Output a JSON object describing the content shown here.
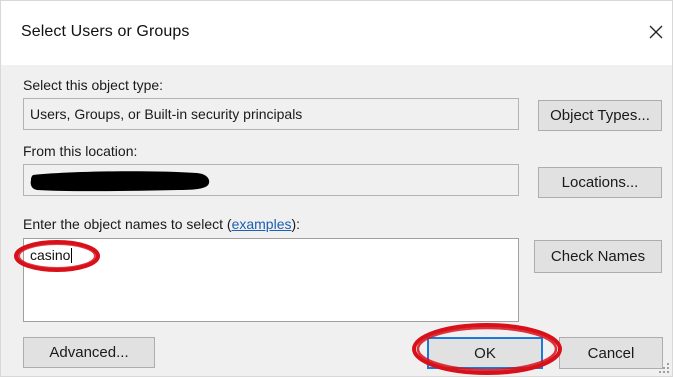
{
  "window": {
    "title": "Select Users or Groups",
    "close_icon": "close-icon"
  },
  "object_type": {
    "label": "Select this object type:",
    "value": "Users, Groups, or Built-in security principals",
    "button_label": "Object Types..."
  },
  "location": {
    "label": "From this location:",
    "value_redacted": true,
    "button_label": "Locations..."
  },
  "names": {
    "label_prefix": "Enter the object names to select (",
    "label_link": "examples",
    "label_suffix": "):",
    "value": "casino",
    "button_label": "Check Names"
  },
  "footer": {
    "advanced_label": "Advanced...",
    "ok_label": "OK",
    "cancel_label": "Cancel"
  },
  "colors": {
    "annotation_red": "#d8101a",
    "redaction_black": "#000000",
    "primary_border": "#1e78d7",
    "link": "#1a5fb4"
  }
}
